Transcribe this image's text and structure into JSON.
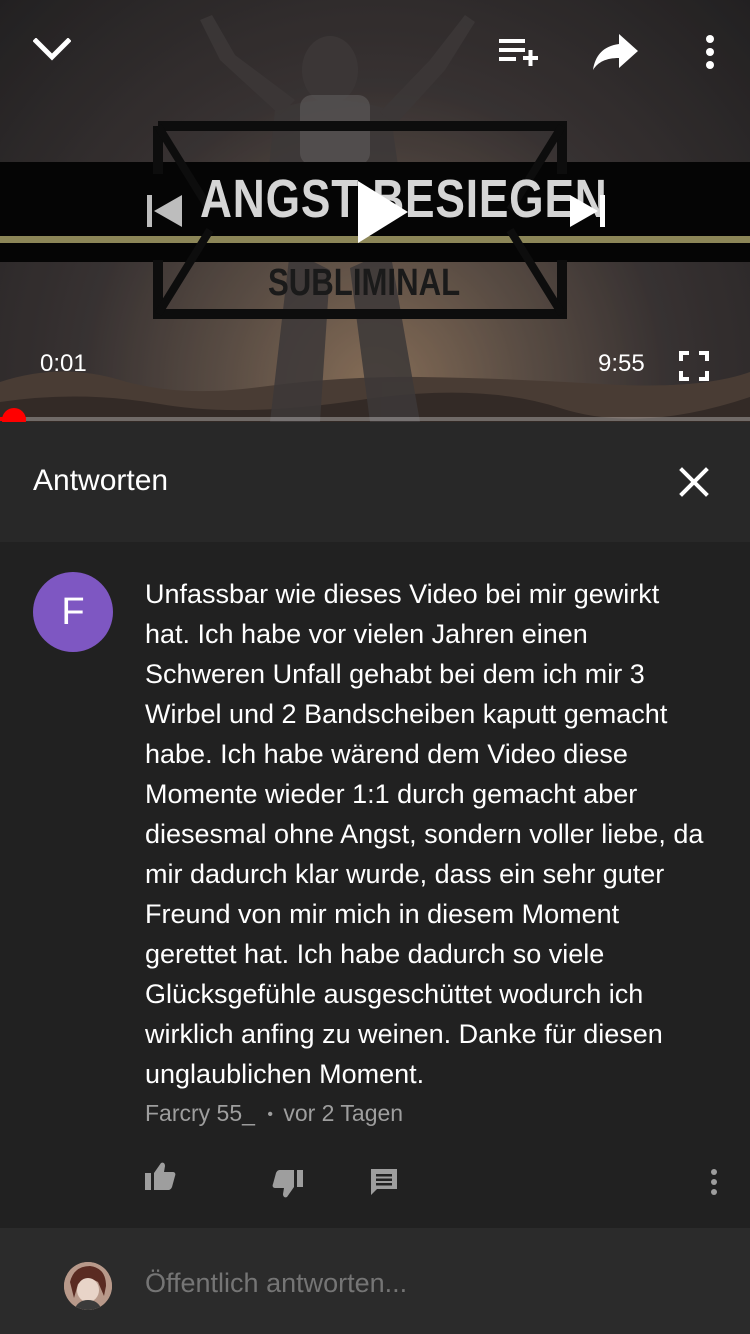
{
  "player": {
    "title_art_line1": "ANGST BESIEGEN",
    "title_art_line2": "SUBLIMINAL",
    "time_current": "0:01",
    "time_total": "9:55",
    "progress_fraction": 0.002,
    "icons": {
      "collapse": "chevron-down-icon",
      "add_to_playlist": "playlist-add-icon",
      "share": "share-icon",
      "more": "more-vert-icon",
      "previous": "skip-previous-icon",
      "play": "play-icon",
      "next": "skip-next-icon",
      "fullscreen": "fullscreen-icon"
    },
    "accent": "#ff0000"
  },
  "replies_panel": {
    "title": "Antworten",
    "close_icon": "close-icon"
  },
  "comment": {
    "avatar_letter": "F",
    "avatar_color": "#7e57c2",
    "text": "Unfassbar wie dieses Video bei mir gewirkt\nhat. Ich habe vor vielen Jahren einen\nSchweren Unfall gehabt bei dem ich mir 3\nWirbel und 2 Bandscheiben kaputt gemacht\nhabe. Ich habe wärend dem Video diese\nMomente wieder 1:1 durch gemacht aber\ndiesesmal ohne Angst, sondern voller liebe, da\nmir dadurch klar wurde, dass ein sehr guter\nFreund von mir mich in diesem Moment\ngerettet hat. Ich habe dadurch so viele\nGlücksgefühle ausgeschüttet wodurch ich\nwirklich anfing zu weinen. Danke für diesen\nunglaublichen Moment.",
    "author": "Farcry 55_",
    "separator": "•",
    "time": "vor 2 Tagen",
    "actions": [
      "thumb-up-icon",
      "thumb-down-icon",
      "reply-icon",
      "more-vert-icon"
    ]
  },
  "reply_bar": {
    "placeholder": "Öffentlich antworten..."
  }
}
